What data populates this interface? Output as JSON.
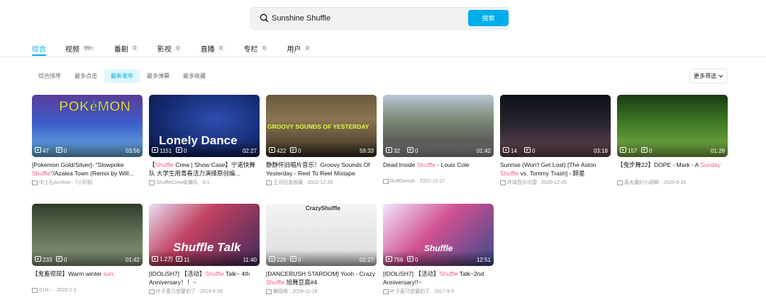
{
  "search": {
    "query": "Sunshine Shuffle",
    "button": "搜索"
  },
  "tabs": [
    {
      "label": "综合",
      "badge": ""
    },
    {
      "label": "视频",
      "badge": "99+"
    },
    {
      "label": "番剧",
      "badge": "0"
    },
    {
      "label": "影视",
      "badge": "0"
    },
    {
      "label": "直播",
      "badge": "0"
    },
    {
      "label": "专栏",
      "badge": "0"
    },
    {
      "label": "用户",
      "badge": "0"
    }
  ],
  "sorts": [
    "综合排序",
    "最多点击",
    "最新发布",
    "最多弹幕",
    "最多收藏"
  ],
  "active_sort": "最新发布",
  "filter_label": "更多筛选",
  "videos": [
    {
      "title_pre": "[Pokemon Gold/Silver]- \"Slowpoke ",
      "title_hl": "Shuffle",
      "title_post": "\"/Azalea Town (Remix by Will...",
      "views": "47",
      "danmaku": "0",
      "duration": "03:56",
      "uploader": "中上石Archive",
      "date": "7小时前",
      "thumb_text": "POKéMON"
    },
    {
      "title_pre": "【",
      "title_hl": "Shuffle",
      "title_post": " Crew | Show Case】宁诺快舞队 大学生用青春活力演绎原创编...",
      "views": "1151",
      "danmaku": "0",
      "duration": "02:27",
      "uploader": "ShuffleCrew街舞队",
      "date": "3-1",
      "thumb_text": "Lonely Dance"
    },
    {
      "title_pre": "静静怀旧唱片音乐！Groovy Sounds Of Yesterday - Reel To Reel Mixtape",
      "title_hl": "",
      "title_post": "",
      "views": "422",
      "danmaku": "0",
      "duration": "59:33",
      "uploader": "王河旧金收藏",
      "date": "2022-12-28",
      "thumb_text": "GROOVY SOUNDS OF YESTERDAY"
    },
    {
      "title_pre": "Dead Inside ",
      "title_hl": "Shuffle",
      "title_post": " - Louis Cole",
      "views": "32",
      "danmaku": "0",
      "duration": "01:42",
      "uploader": "RuffDemon",
      "date": "2022-12-27",
      "thumb_text": ""
    },
    {
      "title_pre": "Sunrise (Won't Get Lost) [The Aston ",
      "title_hl": "Shuffle",
      "title_post": " vs. Tommy Trash] - 醉星",
      "views": "14",
      "danmaku": "0",
      "duration": "03:18",
      "uploader": "环球音乐中国",
      "date": "2020-12-25",
      "thumb_text": ""
    },
    {
      "title_pre": "【曳步舞22】DOPE - Mark - A ",
      "title_hl": "Sunday",
      "title_post": "",
      "views": "157",
      "danmaku": "0",
      "duration": "01:28",
      "uploader": "喜大魔的小胡卿",
      "date": "2020-5-18",
      "thumb_text": ""
    },
    {
      "title_pre": "【鬼畜视现】Warm winter ",
      "title_hl": "sun",
      "title_post": "",
      "views": "233",
      "danmaku": "0",
      "duration": "01:42",
      "uploader": "S1N--",
      "date": "2020-2-3",
      "thumb_text": ""
    },
    {
      "title_pre": "[IDOLiSH7] 【活动】",
      "title_hl": "Shuffle",
      "title_post": " Talk~ 4th Anniversary！！~",
      "views": "1.2万",
      "danmaku": "11",
      "duration": "11:40",
      "uploader": "叶子麦只想要豹了",
      "date": "2019-8-28",
      "thumb_text": "Shuffle Talk"
    },
    {
      "title_pre": "[DANCERUSH STARDOM] Yooh - Crazy ",
      "title_hl": "Shuffle",
      "title_post": " 旭舞豆腐#4",
      "views": "229",
      "danmaku": "0",
      "duration": "02:27",
      "uploader": "舞蹈眼",
      "date": "2018-11-18",
      "thumb_text": "CrazyShuffle"
    },
    {
      "title_pre": "[IDOLiSH7] 【活动】",
      "title_hl": "Shuffle",
      "title_post": " Talk~2nd Anniversary!!~",
      "views": "756",
      "danmaku": "0",
      "duration": "12:51",
      "uploader": "叶子麦只想要豹了",
      "date": "2017-9-5",
      "thumb_text": "Shuffle"
    }
  ]
}
